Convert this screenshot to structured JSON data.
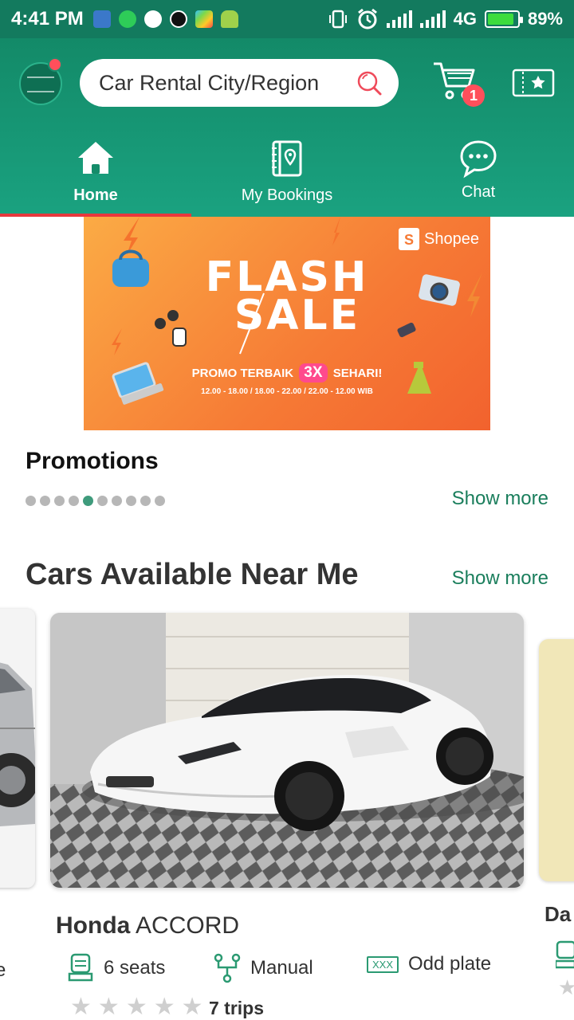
{
  "status_bar": {
    "time": "4:41 PM",
    "network": "4G",
    "battery": "89%",
    "battery_level": 0.89
  },
  "header": {
    "search_placeholder": "Car Rental City/Region",
    "cart_count": "1",
    "icons": [
      "avatar",
      "search-icon",
      "cart-icon",
      "ticket-star-icon"
    ]
  },
  "nav": {
    "items": [
      {
        "label": "Home",
        "icon": "home-icon",
        "active": true
      },
      {
        "label": "My Bookings",
        "icon": "bookings-icon",
        "active": false
      },
      {
        "label": "Chat",
        "icon": "chat-icon",
        "active": false
      }
    ]
  },
  "banner": {
    "brand": "Shopee",
    "title_line1": "FLASH",
    "title_line2": "SALE",
    "promo_prefix": "PROMO TERBAIK",
    "promo_badge": "3X",
    "promo_suffix": "SEHARI!",
    "times": "12.00 - 18.00 / 18.00 - 22.00 / 22.00 - 12.00 WIB"
  },
  "promotions": {
    "heading": "Promotions",
    "show_more": "Show more",
    "dot_count": 10,
    "active_dot": 4
  },
  "cars": {
    "heading": "Cars Available Near Me",
    "show_more": "Show more",
    "featured": {
      "brand": "Honda",
      "model": "ACCORD",
      "seats": "6 seats",
      "transmission": "Manual",
      "plate_badge": "XXX",
      "plate": "Odd plate",
      "rating": 0,
      "trips": "7 trips"
    },
    "next_card_partial": "Da",
    "prev_card_partial": "e"
  },
  "colors": {
    "header_green": "#138a68",
    "accent_green": "#1a7e5c",
    "active_red": "#e8383d",
    "badge_red": "#ff4f5b"
  }
}
